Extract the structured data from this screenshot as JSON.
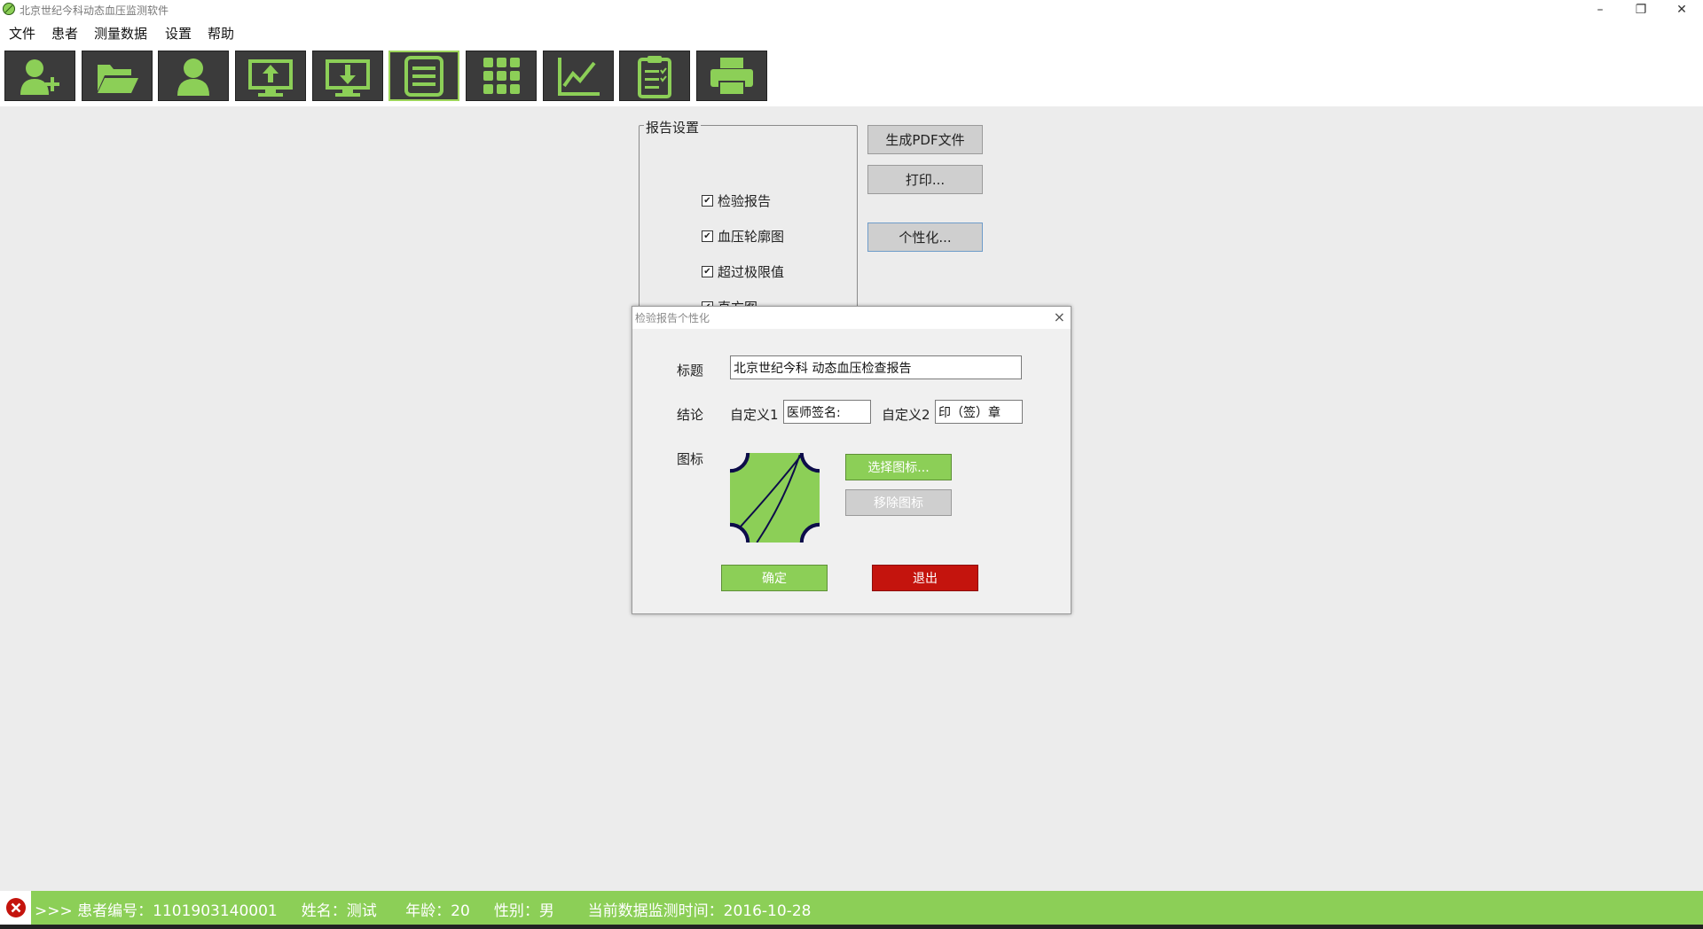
{
  "window": {
    "title": "北京世纪今科动态血压监测软件",
    "controls": [
      "minimize",
      "restore",
      "close"
    ]
  },
  "menu": [
    "文件",
    "患者",
    "测量数据",
    "设置",
    "帮助"
  ],
  "toolbar": {
    "buttons": [
      "add-patient-icon",
      "open-folder-icon",
      "patient-icon",
      "upload-icon",
      "download-icon",
      "list-icon",
      "grid-icon",
      "chart-icon",
      "clipboard-icon",
      "printer-icon"
    ],
    "active": "list-icon",
    "accent": "#8ccf57"
  },
  "report": {
    "group_title": "报告设置",
    "options": [
      {
        "label": "检验报告",
        "checked": true
      },
      {
        "label": "血压轮廓图",
        "checked": true
      },
      {
        "label": "超过极限值",
        "checked": true
      },
      {
        "label": "直方图",
        "checked": true
      }
    ],
    "generate_pdf": "生成PDF文件",
    "print": "打印...",
    "personalize": "个性化..."
  },
  "dialog": {
    "title": "检验报告个性化",
    "close": "×",
    "title_label": "标题",
    "title_value": "北京世纪今科 动态血压检查报告",
    "conclusion_label": "结论",
    "custom1_label": "自定义1",
    "custom1_value": "医师签名:",
    "custom2_label": "自定义2",
    "custom2_value": "印（签）章",
    "logo_label": "图标",
    "choose_logo": "选择图标...",
    "remove_logo": "移除图标",
    "ok": "确定",
    "exit": "退出"
  },
  "status": {
    "text": ">>> 患者编号：1101903140001     姓名：测试      年龄：20     性别：男       当前数据监测时间：2016-10-28",
    "bg": "#8ccf57"
  }
}
